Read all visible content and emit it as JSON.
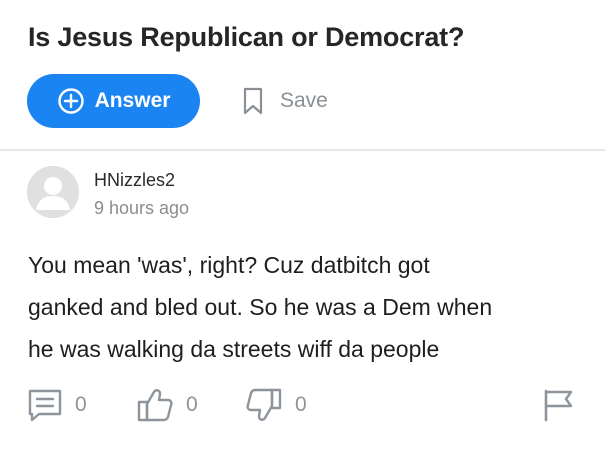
{
  "question": {
    "title": "Is Jesus Republican or Democrat?"
  },
  "actions": {
    "answer_label": "Answer",
    "save_label": "Save"
  },
  "answer": {
    "username": "HNizzles2",
    "timestamp": "9 hours ago",
    "lines": [
      "You mean 'was', right?  Cuz datbitch got",
      "ganked and bled out.  So he was a Dem when",
      "he was walking da streets wiff da people"
    ]
  },
  "reactions": {
    "comments_count": "0",
    "upvotes_count": "0",
    "downvotes_count": "0"
  },
  "colors": {
    "accent": "#1a84f2",
    "icon_gray": "#8e949b"
  },
  "icons": [
    "plus-circle-icon",
    "bookmark-icon",
    "comment-icon",
    "thumbs-up-icon",
    "thumbs-down-icon",
    "flag-icon",
    "avatar-placeholder-icon"
  ]
}
